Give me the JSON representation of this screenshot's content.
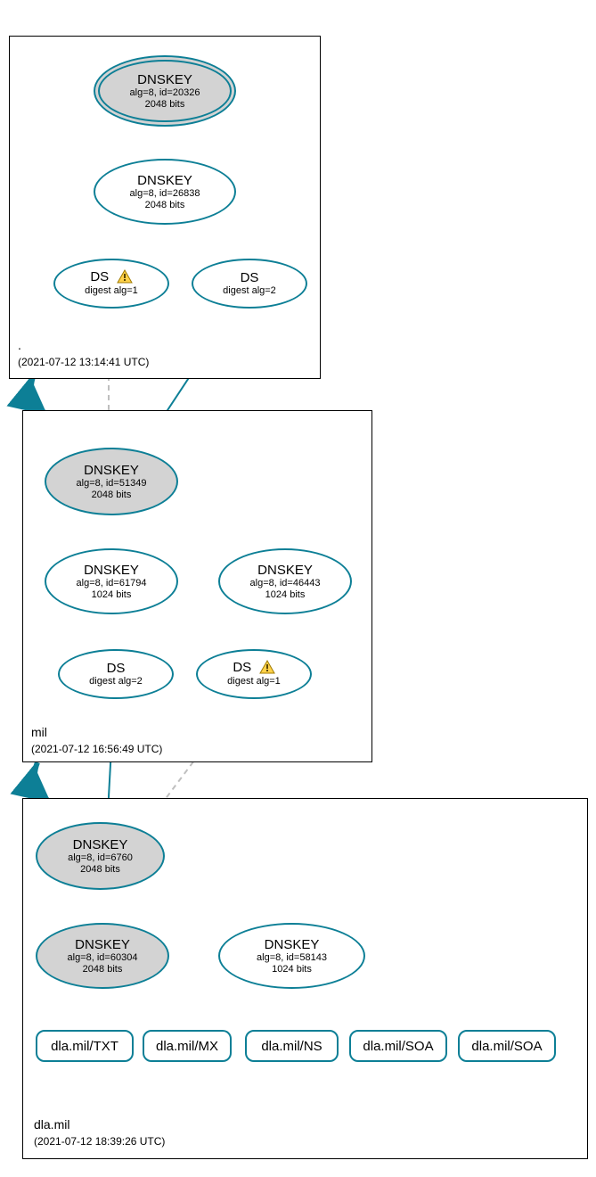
{
  "colors": {
    "stroke": "#0d7f96",
    "grey": "#d3d3d3",
    "dashed": "#bfbfbf"
  },
  "clusters": {
    "root": {
      "label_line1": ".",
      "label_line2": "(2021-07-12 13:14:41 UTC)"
    },
    "mil": {
      "label_line1": "mil",
      "label_line2": "(2021-07-12 16:56:49 UTC)"
    },
    "dla": {
      "label_line1": "dla.mil",
      "label_line2": "(2021-07-12 18:39:26 UTC)"
    }
  },
  "nodes": {
    "root_ksk": {
      "title": "DNSKEY",
      "sub": "alg=8, id=20326",
      "sub2": "2048 bits"
    },
    "root_zsk": {
      "title": "DNSKEY",
      "sub": "alg=8, id=26838",
      "sub2": "2048 bits"
    },
    "root_ds1": {
      "title": "DS",
      "sub": "digest alg=1",
      "warn": true
    },
    "root_ds2": {
      "title": "DS",
      "sub": "digest alg=2"
    },
    "mil_ksk": {
      "title": "DNSKEY",
      "sub": "alg=8, id=51349",
      "sub2": "2048 bits"
    },
    "mil_zsk": {
      "title": "DNSKEY",
      "sub": "alg=8, id=61794",
      "sub2": "1024 bits"
    },
    "mil_zsk2": {
      "title": "DNSKEY",
      "sub": "alg=8, id=46443",
      "sub2": "1024 bits"
    },
    "mil_ds2": {
      "title": "DS",
      "sub": "digest alg=2"
    },
    "mil_ds1": {
      "title": "DS",
      "sub": "digest alg=1",
      "warn": true
    },
    "dla_ksk": {
      "title": "DNSKEY",
      "sub": "alg=8, id=6760",
      "sub2": "2048 bits"
    },
    "dla_zsk2": {
      "title": "DNSKEY",
      "sub": "alg=8, id=60304",
      "sub2": "2048 bits"
    },
    "dla_zsk": {
      "title": "DNSKEY",
      "sub": "alg=8, id=58143",
      "sub2": "1024 bits"
    }
  },
  "rr": {
    "txt": "dla.mil/TXT",
    "mx": "dla.mil/MX",
    "ns": "dla.mil/NS",
    "soa1": "dla.mil/SOA",
    "soa2": "dla.mil/SOA"
  },
  "chart_data": {
    "type": "diagram",
    "description": "DNSSEC authentication chain (DNSViz-style) for dla.mil via mil via root. Ellipses are DNSKEY/DS records; grey ellipses are KSK/SEP keys; double-ring = trust anchor; warning triangles on DS digest alg=1 nodes indicate insecure digest algorithm. Rounded rectangles at bottom are RRsets signed by the dla.mil ZSK.",
    "zones": [
      {
        "name": ".",
        "timestamp_utc": "2021-07-12 13:14:41",
        "keys": [
          {
            "id": 20326,
            "alg": 8,
            "bits": 2048,
            "role": "KSK",
            "trust_anchor": true
          },
          {
            "id": 26838,
            "alg": 8,
            "bits": 2048,
            "role": "ZSK"
          }
        ],
        "ds_for_child": [
          {
            "child": "mil",
            "digest_alg": 1,
            "warning": true
          },
          {
            "child": "mil",
            "digest_alg": 2
          }
        ]
      },
      {
        "name": "mil",
        "timestamp_utc": "2021-07-12 16:56:49",
        "keys": [
          {
            "id": 51349,
            "alg": 8,
            "bits": 2048,
            "role": "KSK"
          },
          {
            "id": 61794,
            "alg": 8,
            "bits": 1024,
            "role": "ZSK"
          },
          {
            "id": 46443,
            "alg": 8,
            "bits": 1024,
            "role": "ZSK"
          }
        ],
        "ds_for_child": [
          {
            "child": "dla.mil",
            "digest_alg": 1,
            "warning": true
          },
          {
            "child": "dla.mil",
            "digest_alg": 2
          }
        ]
      },
      {
        "name": "dla.mil",
        "timestamp_utc": "2021-07-12 18:39:26",
        "keys": [
          {
            "id": 6760,
            "alg": 8,
            "bits": 2048,
            "role": "KSK"
          },
          {
            "id": 60304,
            "alg": 8,
            "bits": 2048,
            "role": "ZSK"
          },
          {
            "id": 58143,
            "alg": 8,
            "bits": 1024,
            "role": "ZSK"
          }
        ],
        "rrsets": [
          "dla.mil/TXT",
          "dla.mil/MX",
          "dla.mil/NS",
          "dla.mil/SOA",
          "dla.mil/SOA"
        ]
      }
    ],
    "edges": [
      {
        "from": "root.20326",
        "to": "root.20326",
        "type": "self-sign"
      },
      {
        "from": "root.20326",
        "to": "root.26838",
        "type": "signs"
      },
      {
        "from": "root.26838",
        "to": "root.DS.alg1",
        "type": "signs"
      },
      {
        "from": "root.26838",
        "to": "root.DS.alg2",
        "type": "signs"
      },
      {
        "from": "root.DS.alg1",
        "to": "mil.51349",
        "type": "delegation",
        "insecure": true
      },
      {
        "from": "root.DS.alg2",
        "to": "mil.51349",
        "type": "delegation"
      },
      {
        "from": "mil.51349",
        "to": "mil.51349",
        "type": "self-sign"
      },
      {
        "from": "mil.51349",
        "to": "mil.61794",
        "type": "signs"
      },
      {
        "from": "mil.51349",
        "to": "mil.46443",
        "type": "signs"
      },
      {
        "from": "mil.61794",
        "to": "mil.61794",
        "type": "self-sign"
      },
      {
        "from": "mil.61794",
        "to": "mil.DS.alg2",
        "type": "signs"
      },
      {
        "from": "mil.61794",
        "to": "mil.DS.alg1",
        "type": "signs"
      },
      {
        "from": "mil.DS.alg2",
        "to": "dla.6760",
        "type": "delegation"
      },
      {
        "from": "mil.DS.alg1",
        "to": "dla.6760",
        "type": "delegation",
        "insecure": true
      },
      {
        "from": "dla.6760",
        "to": "dla.6760",
        "type": "self-sign"
      },
      {
        "from": "dla.6760",
        "to": "dla.60304",
        "type": "signs"
      },
      {
        "from": "dla.60304",
        "to": "dla.60304",
        "type": "self-sign"
      },
      {
        "from": "dla.6760",
        "to": "dla.58143",
        "type": "signs"
      },
      {
        "from": "dla.58143",
        "to": "dla.58143",
        "type": "self-sign"
      },
      {
        "from": "dla.58143",
        "to": "dla.mil/TXT",
        "type": "signs"
      },
      {
        "from": "dla.58143",
        "to": "dla.mil/MX",
        "type": "signs"
      },
      {
        "from": "dla.58143",
        "to": "dla.mil/NS",
        "type": "signs"
      },
      {
        "from": "dla.58143",
        "to": "dla.mil/SOA",
        "type": "signs"
      },
      {
        "from": "dla.58143",
        "to": "dla.mil/SOA",
        "type": "signs"
      }
    ]
  }
}
